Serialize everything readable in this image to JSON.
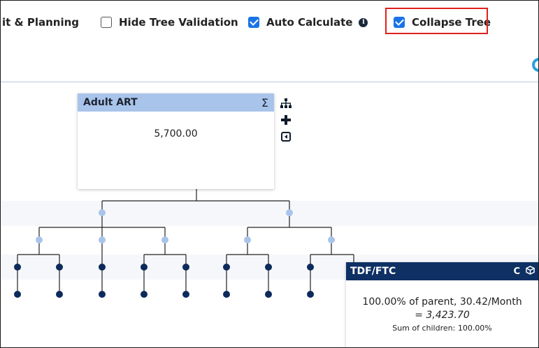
{
  "toolbar": {
    "truncated_label": "it & Planning",
    "hide_tree_validation": {
      "label": "Hide Tree Validation",
      "checked": false
    },
    "auto_calculate": {
      "label": "Auto Calculate",
      "checked": true,
      "info_icon": "info-icon"
    },
    "collapse_tree": {
      "label": "Collapse Tree",
      "checked": true
    }
  },
  "root_node": {
    "title": "Adult ART",
    "sum_symbol": "Σ",
    "value": "5,700.00",
    "side_icons": [
      "sitemap-icon",
      "plus-icon",
      "collapse-left-icon"
    ]
  },
  "detail_node": {
    "title": "TDF/FTC",
    "header_icons": [
      "c-icon",
      "cube-icon"
    ],
    "c_label": "C",
    "line1": "100.00% of parent, 30.42/Month",
    "line2": "= 3,423.70",
    "line3": "Sum of children: 100.00%"
  },
  "colors": {
    "accent": "#1a73e8",
    "highlight_border": "#e0201c",
    "root_header": "#a9c4ea",
    "detail_header": "#0e3063",
    "leaf_node": "#0d2a5c",
    "mid_node": "#a9c4ea",
    "refresh": "#2e9fd6"
  }
}
